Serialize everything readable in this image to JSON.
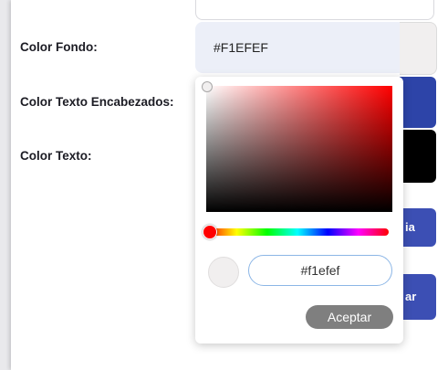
{
  "form": {
    "background_label": "Color Fondo:",
    "background_value": "#F1EFEF",
    "header_text_label": "Color Texto Encabezados:",
    "text_label": "Color Texto:",
    "button_a_partial": "ia",
    "button_b_partial": "ar"
  },
  "picker": {
    "hex_value": "#f1efef",
    "accept_label": "Aceptar",
    "hue": "#ff0000"
  },
  "colors": {
    "background_swatch": "#f1efef",
    "header_text_swatch": "#2d44a8",
    "text_swatch": "#000000",
    "button": "#3c4fb4"
  }
}
